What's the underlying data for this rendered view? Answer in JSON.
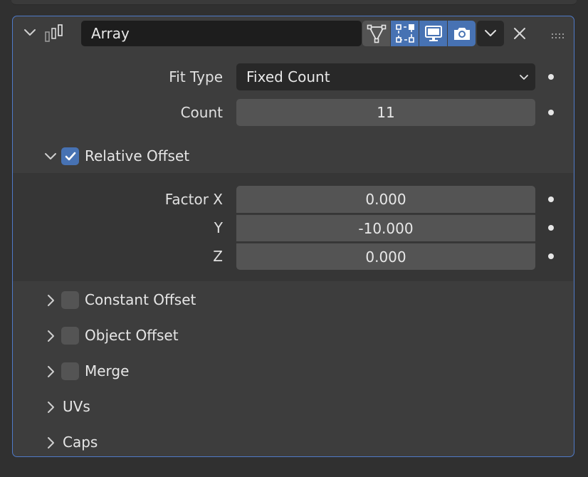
{
  "modifier": {
    "name": "Array",
    "icon": "array-modifier-icon",
    "toggles": [
      "edit-mode-icon",
      "cage-icon",
      "viewport-display-icon",
      "render-icon"
    ]
  },
  "fields": {
    "fit_type": {
      "label": "Fit Type",
      "value": "Fixed Count"
    },
    "count": {
      "label": "Count",
      "value": "11"
    }
  },
  "relative_offset": {
    "label": "Relative Offset",
    "checked": true,
    "expanded": true,
    "factor_x": {
      "label": "Factor X",
      "value": "0.000"
    },
    "y": {
      "label": "Y",
      "value": "-10.000"
    },
    "z": {
      "label": "Z",
      "value": "0.000"
    }
  },
  "sections": {
    "constant_offset": "Constant Offset",
    "object_offset": "Object Offset",
    "merge": "Merge",
    "uvs": "UVs",
    "caps": "Caps"
  },
  "colors": {
    "accent": "#4772b3",
    "panel_border": "#4f7ac8",
    "panel_bg": "#3d3d3d",
    "field_bg": "#545454",
    "dropdown_bg": "#282828"
  }
}
